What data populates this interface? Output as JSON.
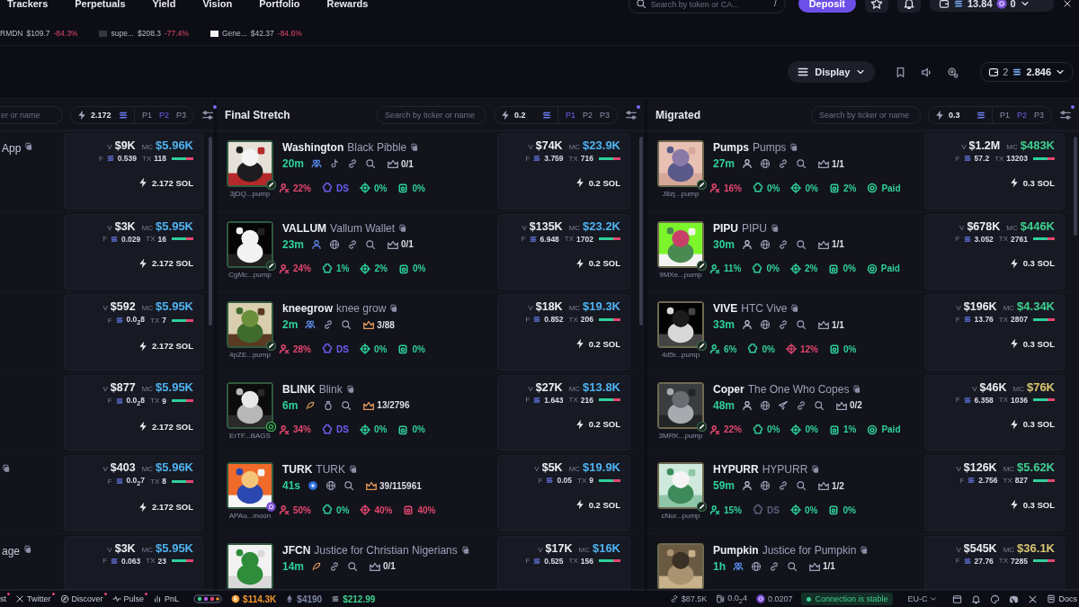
{
  "nav": {
    "links": [
      "Trackers",
      "Perpetuals",
      "Yield",
      "Vision",
      "Portfolio",
      "Rewards"
    ],
    "search": {
      "placeholder": "Search by token or CA...",
      "shortcut": "/"
    },
    "deposit": "Deposit",
    "wallet": {
      "balance": "13.84",
      "count": "0"
    }
  },
  "tickers": [
    {
      "name": "RMDN",
      "price": "$109.7",
      "change": "-84.3%",
      "icon": false
    },
    {
      "name": "supe...",
      "price": "$208.3",
      "change": "-77.4%",
      "icon": true,
      "color": "#34363f"
    },
    {
      "name": "Gene...",
      "price": "$42.37",
      "change": "-84.6%",
      "icon": true,
      "color": "#f2f2f2"
    }
  ],
  "toolbar": {
    "display": "Display",
    "wallets": "2",
    "balance": "2.846"
  },
  "columns": [
    {
      "kind": "cut",
      "search": {
        "placeholder": "er or name"
      },
      "amount": "2.172",
      "presets": [
        {
          "label": "P1",
          "selected": false
        },
        {
          "label": "P2",
          "selected": true
        },
        {
          "label": "P3",
          "selected": false
        }
      ],
      "rows": [
        {
          "fragment": "App",
          "copy": true,
          "v": {
            "label": "V",
            "value": "$9K"
          },
          "mc": {
            "label": "MC",
            "value": "$5.96K",
            "color": "#4fb3f0"
          },
          "f": {
            "label": "F",
            "value": "0.539"
          },
          "tx": {
            "label": "TX",
            "value": "118"
          },
          "buy": "2.172 SOL"
        },
        {
          "copy": false,
          "v": {
            "label": "V",
            "value": "$3K"
          },
          "mc": {
            "label": "MC",
            "value": "$5.95K",
            "color": "#4fb3f0"
          },
          "f": {
            "label": "F",
            "value": "0.029"
          },
          "tx": {
            "label": "TX",
            "value": "16"
          },
          "buy": "2.172 SOL"
        },
        {
          "copy": false,
          "v": {
            "label": "V",
            "value": "$592"
          },
          "mc": {
            "label": "MC",
            "value": "$5.95K",
            "color": "#4fb3f0"
          },
          "f": {
            "label": "F",
            "value": "0.0$_{2}$8"
          },
          "tx": {
            "label": "TX",
            "value": "7"
          },
          "buy": "2.172 SOL"
        },
        {
          "copy": false,
          "v": {
            "label": "V",
            "value": "$877"
          },
          "mc": {
            "label": "MC",
            "value": "$5.95K",
            "color": "#4fb3f0"
          },
          "f": {
            "label": "F",
            "value": "0.0$_{2}$8"
          },
          "tx": {
            "label": "TX",
            "value": "9"
          },
          "buy": "2.172 SOL"
        },
        {
          "copy": true,
          "v": {
            "label": "V",
            "value": "$403"
          },
          "mc": {
            "label": "MC",
            "value": "$5.96K",
            "color": "#4fb3f0"
          },
          "f": {
            "label": "F",
            "value": "0.0$_{2}$7"
          },
          "tx": {
            "label": "TX",
            "value": "8"
          },
          "buy": "2.172 SOL"
        },
        {
          "fragment": "age",
          "copy": true,
          "v": {
            "label": "V",
            "value": "$3K"
          },
          "mc": {
            "label": "MC",
            "value": "$5.95K",
            "color": "#4fb3f0"
          },
          "f": {
            "label": "F",
            "value": "0.063"
          },
          "tx": {
            "label": "TX",
            "value": "23"
          }
        }
      ]
    },
    {
      "kind": "full",
      "title": "Final Stretch",
      "search": {
        "placeholder": "Search by ticker or name"
      },
      "amount": "0.2",
      "presets": [
        {
          "label": "P1",
          "selected": true
        },
        {
          "label": "P2",
          "selected": false
        },
        {
          "label": "P3",
          "selected": false
        }
      ],
      "rows": [
        {
          "ticker": "Washington",
          "name": "Black Pibble",
          "age": "20m",
          "socials": [
            {
              "kind": "community"
            },
            {
              "kind": "tiktok"
            },
            {
              "kind": "link"
            },
            {
              "kind": "search"
            }
          ],
          "holders": "0/1",
          "hot": false,
          "stats": [
            {
              "kind": "holders",
              "value": "22%",
              "color": "#e4476f"
            },
            {
              "kind": "bundle",
              "value": "DS",
              "color": "#6b5ff0"
            },
            {
              "kind": "sniper",
              "value": "0%",
              "color": "#2fd19a"
            },
            {
              "kind": "insider",
              "value": "0%",
              "color": "#2fd19a"
            }
          ],
          "address": "3jDQ...pump",
          "badge": {
            "kind": "pill"
          },
          "v": {
            "label": "V",
            "value": "$74K"
          },
          "mc": {
            "label": "MC",
            "value": "$23.9K",
            "color": "#4fb3f0"
          },
          "f": {
            "label": "F",
            "value": "3.759"
          },
          "tx": {
            "label": "TX",
            "value": "716"
          },
          "buy": "0.2 SOL"
        },
        {
          "ticker": "VALLUM",
          "name": "Vallum Wallet",
          "age": "23m",
          "socials": [
            {
              "kind": "person"
            },
            {
              "kind": "globe"
            },
            {
              "kind": "link"
            },
            {
              "kind": "search"
            }
          ],
          "holders": "0/1",
          "hot": false,
          "stats": [
            {
              "kind": "holders",
              "value": "24%",
              "color": "#e4476f"
            },
            {
              "kind": "bundle",
              "value": "1%",
              "color": "#2fd19a"
            },
            {
              "kind": "sniper",
              "value": "2%",
              "color": "#2fd19a"
            },
            {
              "kind": "insider",
              "value": "0%",
              "color": "#2fd19a"
            }
          ],
          "address": "CgMc...pump",
          "badge": {
            "kind": "pill"
          },
          "v": {
            "label": "V",
            "value": "$135K"
          },
          "mc": {
            "label": "MC",
            "value": "$23.2K",
            "color": "#4fb3f0"
          },
          "f": {
            "label": "F",
            "value": "6.948"
          },
          "tx": {
            "label": "TX",
            "value": "1702"
          },
          "buy": "0.2 SOL"
        },
        {
          "ticker": "kneegrow",
          "name": "knee grow",
          "age": "2m",
          "socials": [
            {
              "kind": "community"
            },
            {
              "kind": "link"
            },
            {
              "kind": "search"
            }
          ],
          "holders": "3/88",
          "hot": true,
          "stats": [
            {
              "kind": "holders",
              "value": "28%",
              "color": "#e4476f"
            },
            {
              "kind": "bundle",
              "value": "DS",
              "color": "#6b5ff0"
            },
            {
              "kind": "sniper",
              "value": "0%",
              "color": "#2fd19a"
            },
            {
              "kind": "insider",
              "value": "0%",
              "color": "#2fd19a"
            }
          ],
          "address": "4pZE...pump",
          "badge": {
            "kind": "pill"
          },
          "v": {
            "label": "V",
            "value": "$18K"
          },
          "mc": {
            "label": "MC",
            "value": "$19.3K",
            "color": "#4fb3f0"
          },
          "f": {
            "label": "F",
            "value": "0.852"
          },
          "tx": {
            "label": "TX",
            "value": "206"
          },
          "buy": "0.2 SOL"
        },
        {
          "ticker": "BLINK",
          "name": "Blink",
          "age": "6m",
          "socials": [
            {
              "kind": "feather"
            },
            {
              "kind": "moneybag"
            },
            {
              "kind": "search"
            }
          ],
          "holders": "13/2796",
          "hot": true,
          "stats": [
            {
              "kind": "holders",
              "value": "34%",
              "color": "#e4476f"
            },
            {
              "kind": "bundle",
              "value": "DS",
              "color": "#6b5ff0"
            },
            {
              "kind": "sniper",
              "value": "0%",
              "color": "#2fd19a"
            },
            {
              "kind": "insider",
              "value": "0%",
              "color": "#2fd19a"
            }
          ],
          "address": "ErTF...BAGS",
          "badge": {
            "kind": "ring"
          },
          "v": {
            "label": "V",
            "value": "$27K"
          },
          "mc": {
            "label": "MC",
            "value": "$13.8K",
            "color": "#4fb3f0"
          },
          "f": {
            "label": "F",
            "value": "1.643"
          },
          "tx": {
            "label": "TX",
            "value": "216"
          },
          "buy": "0.2 SOL"
        },
        {
          "ticker": "TURK",
          "name": "TURK",
          "age": "41s",
          "socials": [
            {
              "kind": "dot"
            },
            {
              "kind": "globe"
            },
            {
              "kind": "search"
            }
          ],
          "holders": "39/115961",
          "hot": true,
          "stats": [
            {
              "kind": "holders",
              "value": "50%",
              "color": "#e4476f"
            },
            {
              "kind": "bundle",
              "value": "0%",
              "color": "#2fd19a"
            },
            {
              "kind": "sniper",
              "value": "40%",
              "color": "#e4476f"
            },
            {
              "kind": "insider",
              "value": "40%",
              "color": "#e4476f"
            }
          ],
          "address": "APAu...moon",
          "badge": {
            "kind": "coin"
          },
          "v": {
            "label": "V",
            "value": "$5K"
          },
          "mc": {
            "label": "MC",
            "value": "$19.9K",
            "color": "#4fb3f0"
          },
          "f": {
            "label": "F",
            "value": "0.05"
          },
          "tx": {
            "label": "TX",
            "value": "9"
          },
          "buy": "0.2 SOL"
        },
        {
          "ticker": "JFCN",
          "name": "Justice for Christian Nigerians",
          "age": "14m",
          "socials": [
            {
              "kind": "feather"
            },
            {
              "kind": "link"
            },
            {
              "kind": "search"
            }
          ],
          "holders": "0/1",
          "hot": false,
          "v": {
            "label": "V",
            "value": "$17K"
          },
          "mc": {
            "label": "MC",
            "value": "$16K",
            "color": "#4fb3f0"
          },
          "f": {
            "label": "F",
            "value": "0.525"
          },
          "tx": {
            "label": "TX",
            "value": "156"
          }
        }
      ]
    },
    {
      "kind": "full",
      "title": "Migrated",
      "search": {
        "placeholder": "Search by ticker or name"
      },
      "amount": "0.3",
      "presets": [
        {
          "label": "P1",
          "selected": false
        },
        {
          "label": "P2",
          "selected": true
        },
        {
          "label": "P3",
          "selected": false
        }
      ],
      "rows": [
        {
          "ticker": "Pumps",
          "name": "Pumps",
          "age": "27m",
          "socials": [
            {
              "kind": "person"
            },
            {
              "kind": "globe"
            },
            {
              "kind": "link"
            },
            {
              "kind": "search"
            }
          ],
          "holders": "1/1",
          "hot": false,
          "stats": [
            {
              "kind": "holders",
              "value": "16%",
              "color": "#e4476f"
            },
            {
              "kind": "bundle",
              "value": "0%",
              "color": "#2fd19a"
            },
            {
              "kind": "sniper",
              "value": "0%",
              "color": "#2fd19a"
            },
            {
              "kind": "insider",
              "value": "2%",
              "color": "#2fd19a"
            },
            {
              "kind": "paid",
              "value": "Paid",
              "color": "#2fd19a"
            }
          ],
          "address": "J8zj...pump",
          "badge": {
            "kind": "pill"
          },
          "v": {
            "label": "V",
            "value": "$1.2M"
          },
          "mc": {
            "label": "MC",
            "value": "$483K",
            "color": "#3ed08f"
          },
          "f": {
            "label": "F",
            "value": "57.2"
          },
          "tx": {
            "label": "TX",
            "value": "13203"
          },
          "buy": "0.3 SOL"
        },
        {
          "ticker": "PIPU",
          "name": "PIPU",
          "age": "30m",
          "socials": [
            {
              "kind": "person"
            },
            {
              "kind": "globe"
            },
            {
              "kind": "link"
            },
            {
              "kind": "search"
            }
          ],
          "holders": "1/1",
          "hot": false,
          "stats": [
            {
              "kind": "holders",
              "value": "11%",
              "color": "#2fd19a"
            },
            {
              "kind": "bundle",
              "value": "0%",
              "color": "#2fd19a"
            },
            {
              "kind": "sniper",
              "value": "2%",
              "color": "#2fd19a"
            },
            {
              "kind": "insider",
              "value": "0%",
              "color": "#2fd19a"
            },
            {
              "kind": "paid",
              "value": "Paid",
              "color": "#2fd19a"
            }
          ],
          "address": "9MXe...pump",
          "badge": {
            "kind": "pill"
          },
          "v": {
            "label": "V",
            "value": "$678K"
          },
          "mc": {
            "label": "MC",
            "value": "$446K",
            "color": "#3ed08f"
          },
          "f": {
            "label": "F",
            "value": "3.052"
          },
          "tx": {
            "label": "TX",
            "value": "2761"
          },
          "buy": "0.3 SOL"
        },
        {
          "ticker": "VIVE",
          "name": "HTC Vive",
          "age": "33m",
          "socials": [
            {
              "kind": "person"
            },
            {
              "kind": "globe"
            },
            {
              "kind": "link"
            },
            {
              "kind": "search"
            }
          ],
          "holders": "1/1",
          "hot": false,
          "stats": [
            {
              "kind": "holders",
              "value": "6%",
              "color": "#2fd19a"
            },
            {
              "kind": "bundle",
              "value": "0%",
              "color": "#2fd19a"
            },
            {
              "kind": "sniper",
              "value": "12%",
              "color": "#e4476f"
            },
            {
              "kind": "insider",
              "value": "0%",
              "color": "#2fd19a"
            }
          ],
          "address": "4d5r...pump",
          "badge": {
            "kind": "pill"
          },
          "v": {
            "label": "V",
            "value": "$196K"
          },
          "mc": {
            "label": "MC",
            "value": "$4.34K",
            "color": "#3ed08f"
          },
          "f": {
            "label": "F",
            "value": "13.76"
          },
          "tx": {
            "label": "TX",
            "value": "2807"
          },
          "buy": "0.3 SOL"
        },
        {
          "ticker": "Coper",
          "name": "The One Who Copes",
          "age": "48m",
          "socials": [
            {
              "kind": "person"
            },
            {
              "kind": "globe"
            },
            {
              "kind": "telegram"
            },
            {
              "kind": "link"
            },
            {
              "kind": "search"
            }
          ],
          "holders": "0/2",
          "hot": false,
          "stats": [
            {
              "kind": "holders",
              "value": "22%",
              "color": "#e4476f"
            },
            {
              "kind": "bundle",
              "value": "0%",
              "color": "#2fd19a"
            },
            {
              "kind": "sniper",
              "value": "0%",
              "color": "#2fd19a"
            },
            {
              "kind": "insider",
              "value": "1%",
              "color": "#2fd19a"
            },
            {
              "kind": "paid",
              "value": "Paid",
              "color": "#2fd19a"
            }
          ],
          "address": "3MRK...pump",
          "badge": {
            "kind": "pill"
          },
          "v": {
            "label": "V",
            "value": "$46K"
          },
          "mc": {
            "label": "MC",
            "value": "$76K",
            "color": "#d8c670"
          },
          "f": {
            "label": "F",
            "value": "6.358"
          },
          "tx": {
            "label": "TX",
            "value": "1036"
          },
          "buy": "0.3 SOL"
        },
        {
          "ticker": "HYPURR",
          "name": "HYPURR",
          "age": "59m",
          "socials": [
            {
              "kind": "person"
            },
            {
              "kind": "globe"
            },
            {
              "kind": "link"
            },
            {
              "kind": "search"
            }
          ],
          "holders": "1/2",
          "hot": false,
          "stats": [
            {
              "kind": "holders",
              "value": "15%",
              "color": "#2fd19a"
            },
            {
              "kind": "bundle",
              "value": "DS",
              "color": "#5c5f78"
            },
            {
              "kind": "sniper",
              "value": "0%",
              "color": "#2fd19a"
            },
            {
              "kind": "insider",
              "value": "0%",
              "color": "#2fd19a"
            }
          ],
          "address": "cNur...pump",
          "badge": {
            "kind": "pill"
          },
          "v": {
            "label": "V",
            "value": "$126K"
          },
          "mc": {
            "label": "MC",
            "value": "$5.62K",
            "color": "#3ed08f"
          },
          "f": {
            "label": "F",
            "value": "2.756"
          },
          "tx": {
            "label": "TX",
            "value": "827"
          },
          "buy": "0.3 SOL"
        },
        {
          "ticker": "Pumpkin",
          "name": "Justice for Pumpkin",
          "age": "1h",
          "socials": [
            {
              "kind": "community"
            },
            {
              "kind": "globe"
            },
            {
              "kind": "link"
            },
            {
              "kind": "search"
            }
          ],
          "holders": "1/1",
          "hot": false,
          "v": {
            "label": "V",
            "value": "$545K"
          },
          "mc": {
            "label": "MC",
            "value": "$36.1K",
            "color": "#d8c670"
          },
          "f": {
            "label": "F",
            "value": "27.76"
          },
          "tx": {
            "label": "TX",
            "value": "7285"
          }
        }
      ]
    }
  ],
  "footer": {
    "links": [
      {
        "label": "st",
        "kind": "plain",
        "dot": true
      },
      {
        "label": "Twitter",
        "kind": "x",
        "dot": true
      },
      {
        "label": "Discover",
        "kind": "compass",
        "dot": true
      },
      {
        "label": "Pulse",
        "kind": "pulse",
        "dot": true
      },
      {
        "label": "PnL",
        "kind": "bars",
        "dot": false
      }
    ],
    "prices": [
      {
        "kind": "btc",
        "value": "$114.3K",
        "color": "#f0962e"
      },
      {
        "kind": "eth",
        "value": "$4190",
        "color": "#7f86a8"
      },
      {
        "kind": "sol",
        "value": "$212.99",
        "color": "#3ed08f"
      }
    ],
    "metrics": [
      {
        "kind": "link",
        "value": "$87.5K"
      },
      {
        "kind": "gas",
        "value": "0.0$_{2}$4"
      },
      {
        "kind": "coin",
        "value": "0.0207"
      }
    ],
    "connection": "Connection is stable",
    "region": "EU-C",
    "docs": "Docs"
  }
}
